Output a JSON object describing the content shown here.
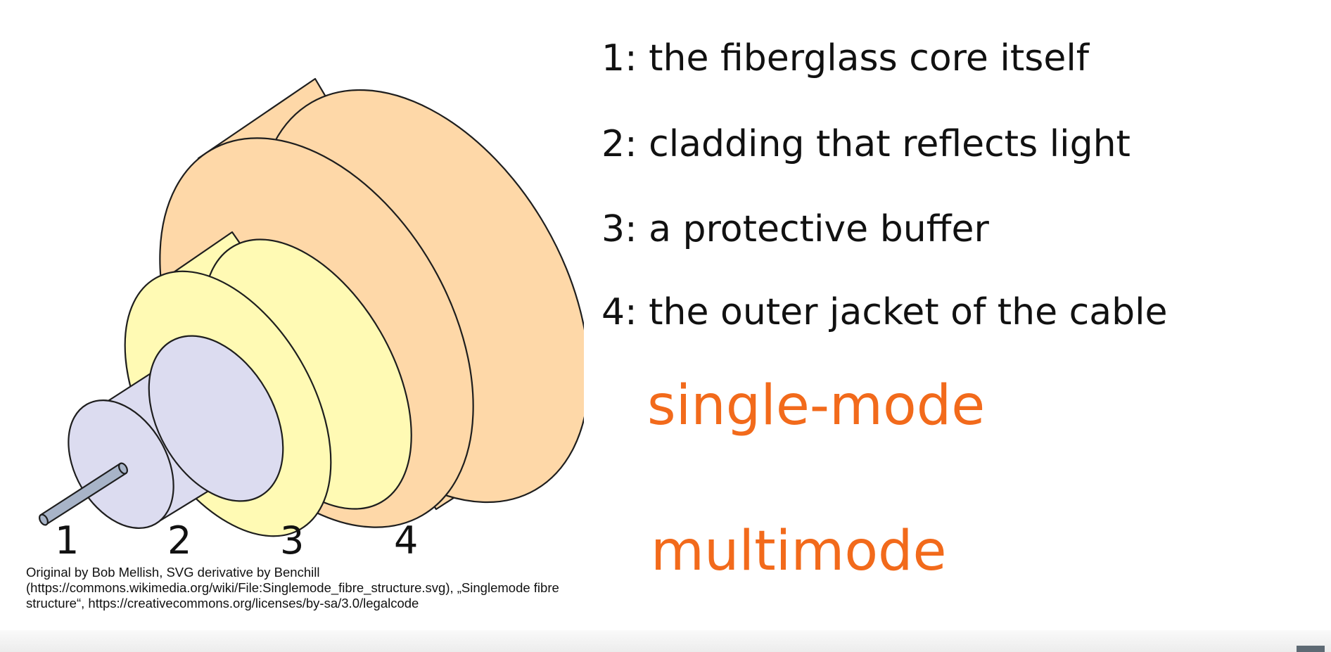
{
  "diagram": {
    "layer_labels": [
      "1",
      "2",
      "3",
      "4"
    ],
    "colors": {
      "jacket": "#fed8a8",
      "buffer": "#fffab4",
      "cladding": "#dcdcf0",
      "core": "#a8b4c8",
      "outline": "#1e1e1e"
    }
  },
  "legend": [
    "1: the fiberglass core itself",
    "2: cladding that reflects light",
    "3: a protective buffer",
    "4: the outer jacket of the cable"
  ],
  "modes": {
    "single": "single-mode",
    "multi": "multimode",
    "color": "#f26a1b"
  },
  "credit": {
    "line1": "Original by Bob Mellish, SVG derivative by Benchill",
    "line2": "(https://commons.wikimedia.org/wiki/File:Singlemode_fibre_structure.svg), „Singlemode fibre",
    "line3": "structure“, https://creativecommons.org/licenses/by-sa/3.0/legalcode"
  }
}
